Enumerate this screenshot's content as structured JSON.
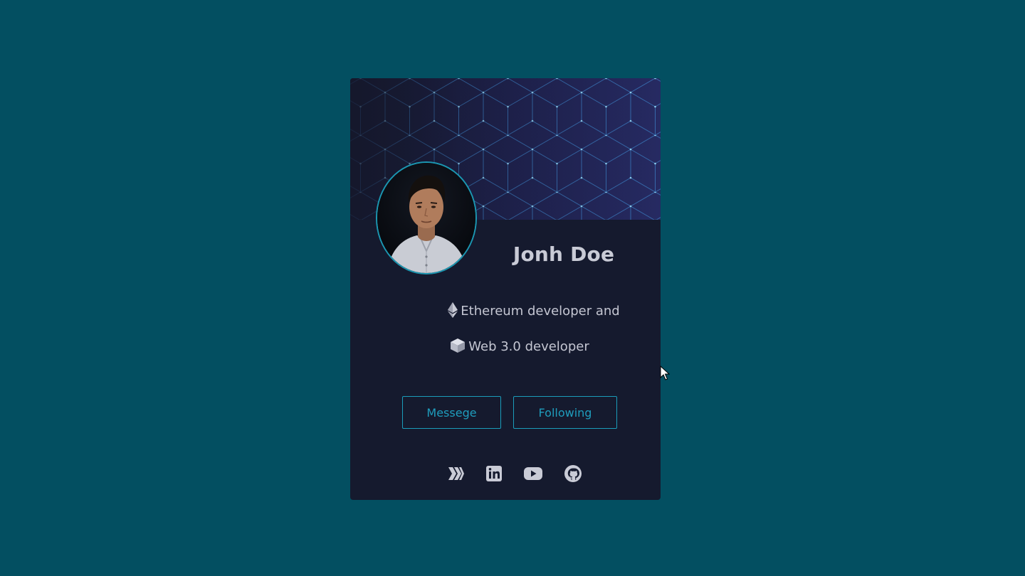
{
  "page": {
    "background_color": "#034f61"
  },
  "card": {
    "name": "Jonh Doe",
    "bio": {
      "line1_icon": "ethereum-icon",
      "line1_text": "Ethereum developer and",
      "line2_icon": "cube-icon",
      "line2_text": "Web 3.0 developer"
    },
    "buttons": {
      "message_label": "Messege",
      "following_label": "Following"
    },
    "socials": [
      {
        "icon": "hive-icon"
      },
      {
        "icon": "linkedin-icon"
      },
      {
        "icon": "youtube-icon"
      },
      {
        "icon": "github-icon"
      }
    ],
    "colors": {
      "card_background": "#151a2e",
      "accent": "#1a9dbb",
      "text": "#c4c6d2"
    }
  }
}
